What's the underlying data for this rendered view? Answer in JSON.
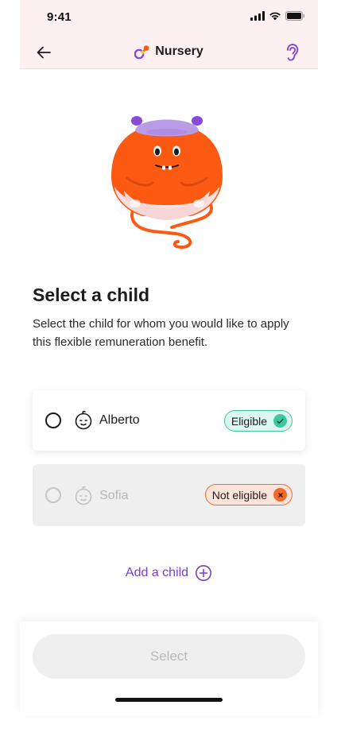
{
  "status_bar": {
    "time": "9:41"
  },
  "nav": {
    "title": "Nursery"
  },
  "content": {
    "heading": "Select a child",
    "subtitle": "Select the child for whom you would like to apply this flexible remuneration benefit."
  },
  "children": [
    {
      "name": "Alberto",
      "status": "Eligible"
    },
    {
      "name": "Sofia",
      "status": "Not eligible"
    }
  ],
  "add_child": {
    "label": "Add a child"
  },
  "footer": {
    "select_label": "Select"
  },
  "colors": {
    "header_bg": "#fdf0f0",
    "accent_purple": "#7b3ed1",
    "eligible_green": "#3cc79f",
    "not_eligible_orange": "#f26a2b",
    "mascot_orange": "#fc5a13"
  }
}
